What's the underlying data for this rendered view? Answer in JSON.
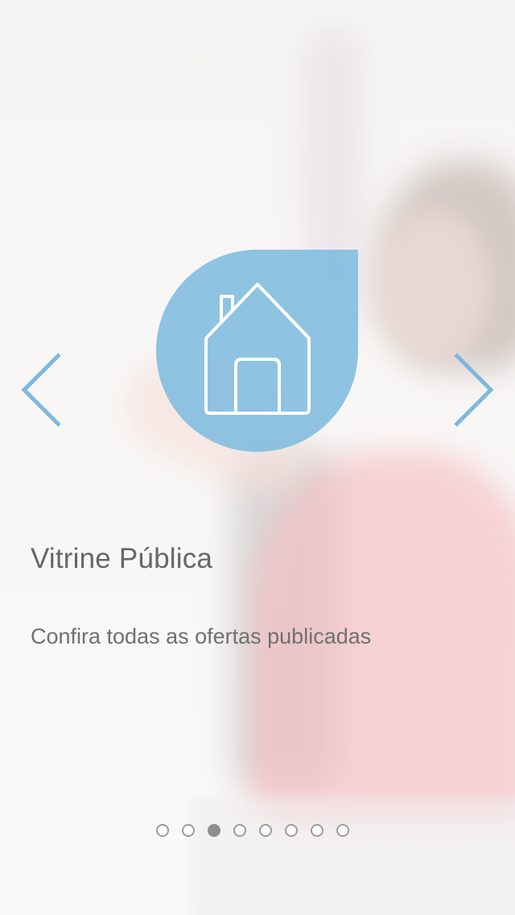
{
  "slide": {
    "title": "Vitrine Pública",
    "subtitle": "Confira todas as ofertas publicadas",
    "icon": "house-icon"
  },
  "navigation": {
    "prev_icon": "chevron-left-icon",
    "next_icon": "chevron-right-icon"
  },
  "pagination": {
    "total": 8,
    "active_index": 2
  },
  "colors": {
    "accent": "#86BEE0",
    "arrow": "#7FB7DE",
    "title": "#666666",
    "subtitle": "#707070",
    "dot_active": "#8E8E8E",
    "dot_border": "#9C9C9C"
  }
}
